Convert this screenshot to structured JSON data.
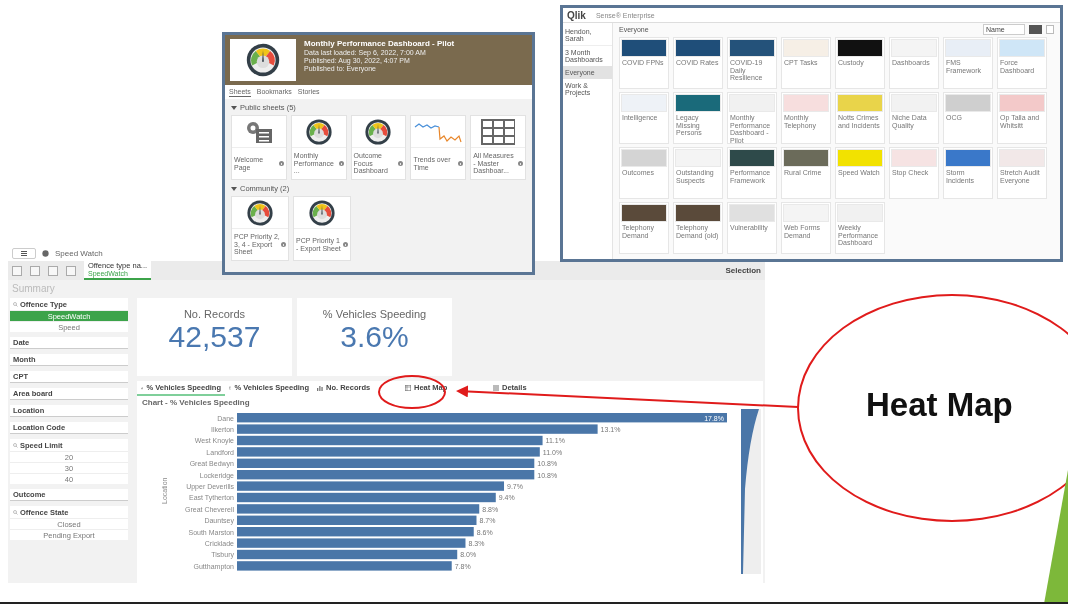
{
  "app": {
    "name": "Speed Watch",
    "selection_chip": {
      "label": "Offence type na...",
      "value": "SpeedWatch"
    },
    "selections_label": "Selection",
    "sheet_title": "Summary",
    "filters": [
      {
        "label": "Offence Type",
        "kind": "list",
        "items": [
          {
            "label": "SpeedWatch",
            "selected": true
          },
          {
            "label": "Speed",
            "selected": false
          }
        ]
      },
      {
        "label": "Date",
        "kind": "collapsed"
      },
      {
        "label": "Month",
        "kind": "collapsed"
      },
      {
        "label": "CPT",
        "kind": "collapsed"
      },
      {
        "label": "Area board",
        "kind": "collapsed"
      },
      {
        "label": "Location",
        "kind": "collapsed"
      },
      {
        "label": "Location Code",
        "kind": "collapsed"
      },
      {
        "label": "Speed Limit",
        "kind": "list",
        "items": [
          {
            "label": "20",
            "selected": false
          },
          {
            "label": "30",
            "selected": false
          },
          {
            "label": "40",
            "selected": false
          }
        ]
      },
      {
        "label": "Outcome",
        "kind": "collapsed"
      },
      {
        "label": "Offence State",
        "kind": "list",
        "items": [
          {
            "label": "Closed",
            "selected": false
          },
          {
            "label": "Pending Export",
            "selected": false
          }
        ]
      }
    ],
    "kpis": [
      {
        "label": "No. Records",
        "value": "42,537"
      },
      {
        "label": "% Vehicles Speeding",
        "value": "3.6%"
      }
    ],
    "chart_tabs": [
      {
        "label": "% Vehicles Speeding",
        "kind": "bar",
        "selected": true
      },
      {
        "label": "% Vehicles Speeding",
        "kind": "table",
        "selected": false
      },
      {
        "label": "No. Records",
        "kind": "bar",
        "selected": false
      },
      {
        "label": "Heat Map",
        "kind": "table",
        "selected": false
      },
      {
        "label": "Details",
        "kind": "list",
        "selected": false
      }
    ],
    "chart": {
      "title": "Chart - % Vehicles Speeding",
      "chart_data": {
        "type": "bar",
        "orientation": "horizontal",
        "ylabel": "Location",
        "categories": [
          "Dane",
          "Ilkerton",
          "West Knoyle",
          "Landford",
          "Great Bedwyn",
          "Lockeridge",
          "Upper Deverills",
          "East Tytherton",
          "Great Cheverell",
          "Dauntsey",
          "South Marston",
          "Cricklade",
          "Tisbury",
          "Gutthampton"
        ],
        "values": [
          17.8,
          13.1,
          11.1,
          11.0,
          10.8,
          10.8,
          9.7,
          9.4,
          8.8,
          8.7,
          8.6,
          8.3,
          8.0,
          7.8
        ],
        "value_labels": [
          "17.8%",
          "13.1%",
          "11.1%",
          "11.0%",
          "10.8%",
          "10.8%",
          "9.7%",
          "9.4%",
          "8.8%",
          "8.7%",
          "8.6%",
          "8.3%",
          "8.0%",
          "7.8%"
        ]
      }
    }
  },
  "overview_window": {
    "title": "Monthly Performance Dashboard - Pilot",
    "meta": [
      "Data last loaded: Sep 6, 2022, 7:00 AM",
      "Published: Aug 30, 2022, 4:07 PM",
      "Published to: Everyone"
    ],
    "tabs": [
      {
        "label": "Sheets",
        "selected": true
      },
      {
        "label": "Bookmarks",
        "selected": false
      },
      {
        "label": "Stories",
        "selected": false
      }
    ],
    "sections": [
      {
        "title": "Public sheets (5)",
        "expanded": true,
        "sheets": [
          {
            "title": "Welcome Page",
            "kind": "settings"
          },
          {
            "title": "Monthly Performance ...",
            "kind": "gauge"
          },
          {
            "title": "Outcome Focus Dashboard",
            "kind": "gauge"
          },
          {
            "title": "Trends over Time",
            "kind": "line"
          },
          {
            "title": "All Measures - Master Dashboar...",
            "kind": "grid"
          }
        ]
      },
      {
        "title": "Community (2)",
        "expanded": true,
        "sheets": [
          {
            "title": "PCP Priority 2, 3, 4 - Export Sheet",
            "kind": "gauge"
          },
          {
            "title": "PCP Priority 1 - Export Sheet",
            "kind": "gauge"
          }
        ]
      }
    ]
  },
  "hub_window": {
    "logo": "Qlik",
    "product": "Sense® Enterprise",
    "user": "Hendon, Sarah",
    "streams": [
      {
        "label": "3 Month Dashboards",
        "selected": false
      },
      {
        "label": "Everyone",
        "selected": true
      },
      {
        "label": "Work & Projects",
        "selected": false
      }
    ],
    "heading": "Everyone",
    "sort": "Name",
    "apps": [
      {
        "title": "COVID FPNs",
        "color": "#1f4e79"
      },
      {
        "title": "COVID Rates",
        "color": "#1f4e79"
      },
      {
        "title": "COVID-19 Daily Resilience",
        "color": "#24527a"
      },
      {
        "title": "CPT Tasks",
        "color": "#f6efe6"
      },
      {
        "title": "Custody",
        "color": "#111111"
      },
      {
        "title": "Dashboards",
        "color": "#f4f4f4"
      },
      {
        "title": "FMS Framework",
        "color": "#e8eef6"
      },
      {
        "title": "Force Dashboard",
        "color": "#cfe6f7"
      },
      {
        "title": "Intelligence",
        "color": "#eef2f7"
      },
      {
        "title": "Legacy Missing Persons",
        "color": "#1a6a7a"
      },
      {
        "title": "Monthly Performance Dashboard - Pilot",
        "color": "#f1f1f1"
      },
      {
        "title": "Monthly Telephony",
        "color": "#f7dede"
      },
      {
        "title": "Notts Crimes and Incidents",
        "color": "#e9d44a"
      },
      {
        "title": "Niche Data Quality",
        "color": "#f2f2f2"
      },
      {
        "title": "OCG",
        "color": "#cfcfcf"
      },
      {
        "title": "Op Talla and Whitsitt",
        "color": "#f3c9c9"
      },
      {
        "title": "Outcomes",
        "color": "#d4d4d4"
      },
      {
        "title": "Outstanding Suspects",
        "color": "#f4f4f4"
      },
      {
        "title": "Performance Framework",
        "color": "#2e4a4a"
      },
      {
        "title": "Rural Crime",
        "color": "#6b6b5a"
      },
      {
        "title": "Speed Watch",
        "color": "#f2e200"
      },
      {
        "title": "Stop Check",
        "color": "#f6e3e3"
      },
      {
        "title": "Storm Incidents",
        "color": "#3a78c9"
      },
      {
        "title": "Stretch Audit Everyone",
        "color": "#f2e8e8"
      },
      {
        "title": "Telephony Demand",
        "color": "#5a4a3a"
      },
      {
        "title": "Telephony Demand (old)",
        "color": "#5a4a3a"
      },
      {
        "title": "Vulnerability",
        "color": "#e0e0e0"
      },
      {
        "title": "Web Forms Demand",
        "color": "#f4f4f4"
      },
      {
        "title": "Weekly Performance Dashboard",
        "color": "#f1f1f1"
      }
    ]
  },
  "callout": {
    "text": "Heat Map"
  }
}
